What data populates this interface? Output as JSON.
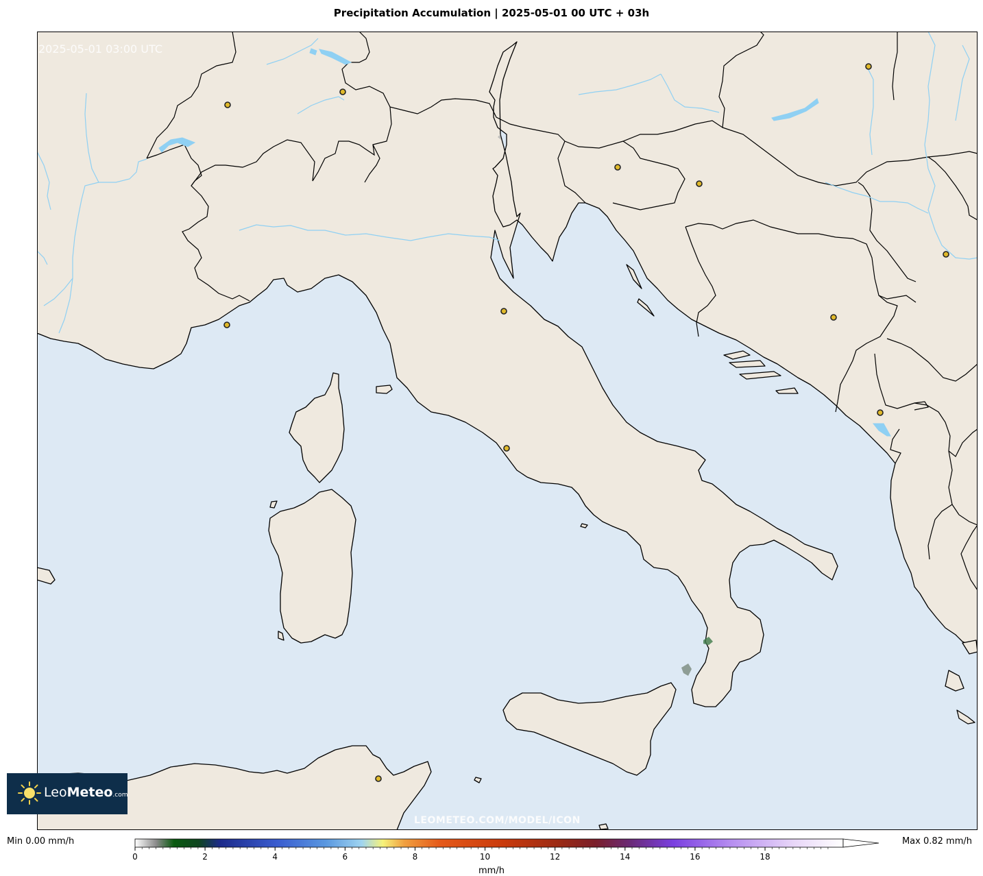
{
  "title": "Precipitation Accumulation | 2025-05-01 00 UTC + 03h",
  "valid_time": "2025-05-01 03:00 UTC",
  "watermark": "LEOMETEO.COM/MODEL/ICON",
  "logo": {
    "name_light": "Leo",
    "name_bold": "Meteo",
    "suffix": ".com"
  },
  "legend": {
    "min_label": "Min 0.00 mm/h",
    "max_label": "Max 0.82 mm/h",
    "unit": "mm/h",
    "ticks": [
      "0",
      "2",
      "4",
      "6",
      "8",
      "10",
      "12",
      "14",
      "16",
      "18"
    ],
    "range": [
      0,
      20
    ]
  },
  "colors": {
    "land": "#efe9df",
    "sea": "#dde9f4",
    "water": "#8fd0f3",
    "border": "#000000",
    "city": "#e0b92b"
  }
}
